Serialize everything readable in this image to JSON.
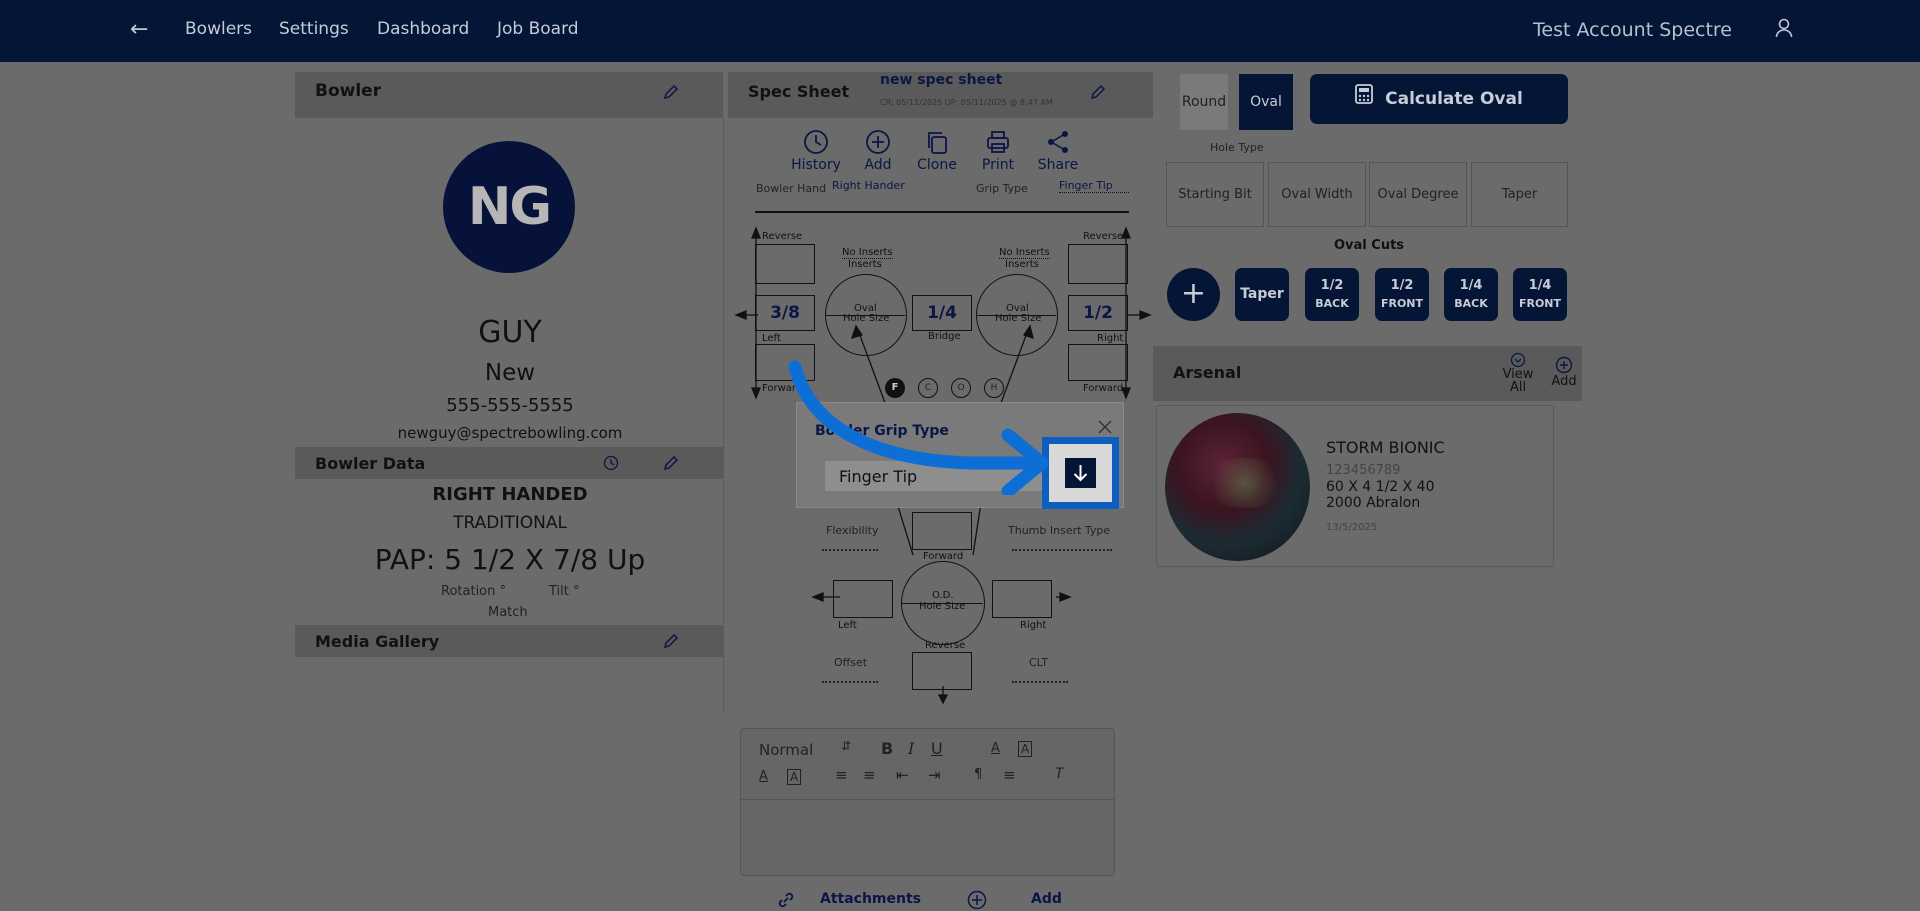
{
  "nav": {
    "links": [
      "Bowlers",
      "Settings",
      "Dashboard",
      "Job Board"
    ],
    "account": "Test Account Spectre"
  },
  "bowler_panel": {
    "title": "Bowler",
    "initials": "NG",
    "first_name": "GUY",
    "last_name": "New",
    "phone": "555-555-5555",
    "email": "newguy@spectrebowling.com"
  },
  "bowler_data": {
    "title": "Bowler Data",
    "hand": "RIGHT HANDED",
    "style": "TRADITIONAL",
    "pap": "PAP: 5 1/2 X 7/8 Up",
    "rotation": "Rotation °",
    "tilt": "Tilt °",
    "match": "Match"
  },
  "media_gallery": {
    "title": "Media Gallery"
  },
  "spec_sheet": {
    "title": "Spec Sheet",
    "sheet_name": "new spec sheet",
    "dates": "CR: 05/11/2025 UP: 05/11/2025 @ 8:47 AM",
    "tools": [
      "History",
      "Add",
      "Clone",
      "Print",
      "Share"
    ],
    "bowler_hand_label": "Bowler Hand",
    "bowler_hand_value": "Right Hander",
    "grip_type_label": "Grip Type",
    "grip_type_value": "Finger Tip",
    "reverse": "Reverse",
    "forward": "Forward",
    "left": "Left",
    "right": "Right",
    "bridge": "Bridge",
    "no_inserts": "No Inserts",
    "inserts": "Inserts",
    "oval": "Oval",
    "hole_size": "Hole Size",
    "od": "O.D.",
    "left_pitch": "3/8",
    "bridge_value": "1/4",
    "right_pitch": "1/2",
    "fingers": [
      "F",
      "C",
      "O",
      "H"
    ],
    "flexibility": "Flexibility",
    "thumb_insert_type": "Thumb Insert Type",
    "offset": "Offset",
    "clt": "CLT"
  },
  "editor": {
    "format": "Normal",
    "attachments": "Attachments",
    "add": "Add"
  },
  "right_panel": {
    "round": "Round",
    "oval": "Oval",
    "calculate": "Calculate Oval",
    "hole_type": "Hole Type",
    "cells": [
      "Starting Bit",
      "Oval Width",
      "Oval Degree",
      "Taper"
    ],
    "oval_cuts": "Oval Cuts",
    "cuts": [
      {
        "top": "Taper",
        "bottom": ""
      },
      {
        "top": "1/2",
        "bottom": "BACK"
      },
      {
        "top": "1/2",
        "bottom": "FRONT"
      },
      {
        "top": "1/4",
        "bottom": "BACK"
      },
      {
        "top": "1/4",
        "bottom": "FRONT"
      }
    ]
  },
  "arsenal": {
    "title": "Arsenal",
    "view_all": "View All",
    "add": "Add",
    "ball": {
      "name": "STORM BIONIC",
      "serial": "123456789",
      "layout": "60 X 4 1/2 X 40",
      "surface": "2000 Abralon",
      "date": "13/5/2025"
    }
  },
  "modal": {
    "title": "Bowler Grip Type",
    "value": "Finger Tip"
  }
}
